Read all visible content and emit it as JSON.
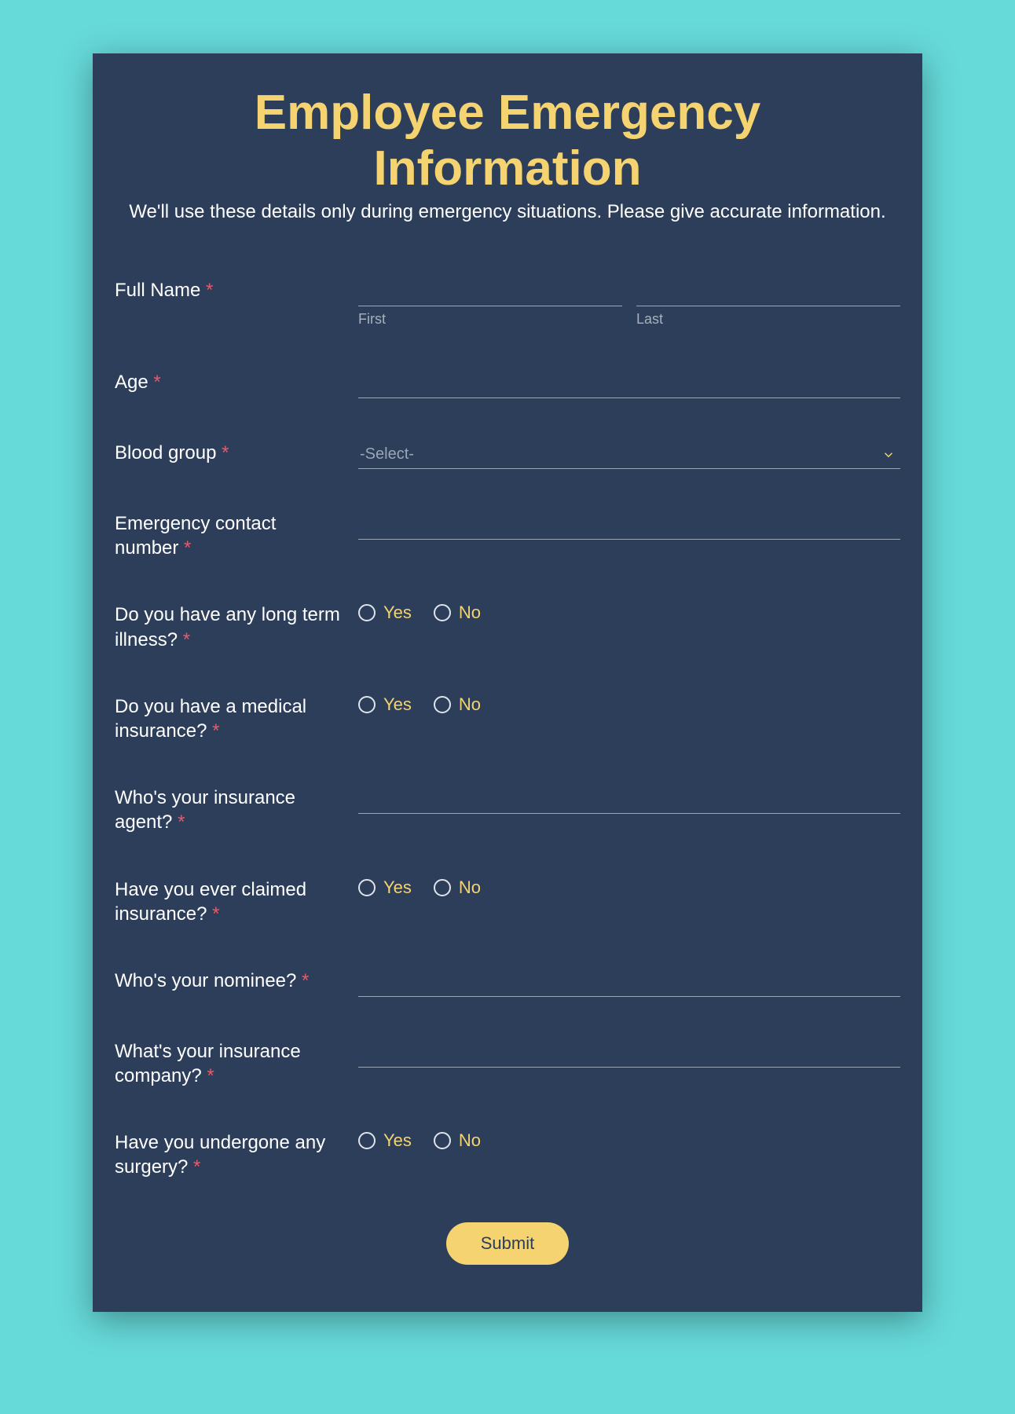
{
  "title": "Employee Emergency Information",
  "subtitle": "We'll use these details only during emergency situations. Please give accurate information.",
  "required_marker": "*",
  "labels": {
    "full_name": "Full Name",
    "first": "First",
    "last": "Last",
    "age": "Age",
    "blood_group": "Blood group",
    "blood_group_placeholder": "-Select-",
    "emergency_contact": "Emergency contact number",
    "long_term_illness": "Do you have any long term illness?",
    "medical_insurance": "Do you have a medical insurance?",
    "insurance_agent": "Who's your insurance agent?",
    "claimed_insurance": "Have you ever claimed insurance?",
    "nominee": "Who's your nominee?",
    "insurance_company": "What's your insurance company?",
    "surgery": "Have you undergone any surgery?"
  },
  "options": {
    "yes": "Yes",
    "no": "No"
  },
  "submit": "Submit"
}
